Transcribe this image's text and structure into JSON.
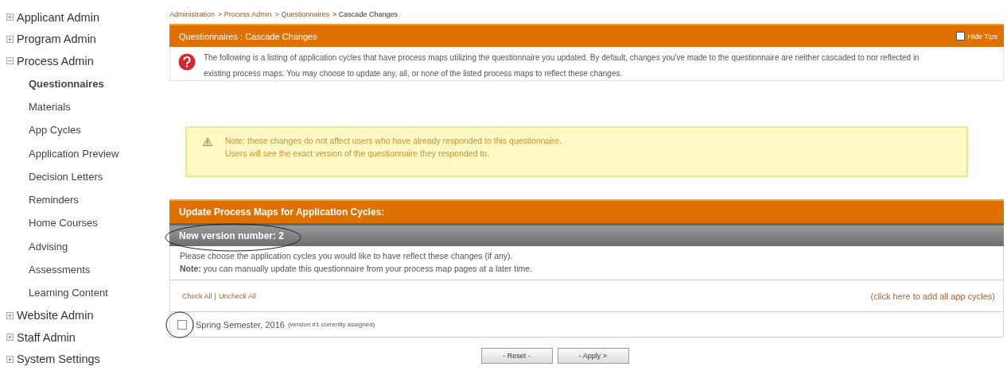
{
  "sidebar": {
    "items": [
      {
        "label": "Applicant Admin",
        "expanded": false
      },
      {
        "label": "Program Admin",
        "expanded": false
      },
      {
        "label": "Process Admin",
        "expanded": true,
        "children": [
          {
            "label": "Questionnaires",
            "selected": true
          },
          {
            "label": "Materials",
            "selected": false
          },
          {
            "label": "App Cycles",
            "selected": false
          },
          {
            "label": "Application Preview",
            "selected": false
          },
          {
            "label": "Decision Letters",
            "selected": false
          },
          {
            "label": "Reminders",
            "selected": false
          },
          {
            "label": "Home Courses",
            "selected": false
          },
          {
            "label": "Advising",
            "selected": false
          },
          {
            "label": "Assessments",
            "selected": false
          },
          {
            "label": "Learning Content",
            "selected": false
          }
        ]
      },
      {
        "label": "Website Admin",
        "expanded": false
      },
      {
        "label": "Staff Admin",
        "expanded": false
      },
      {
        "label": "System Settings",
        "expanded": false
      }
    ]
  },
  "breadcrumb": [
    {
      "label": "Administration",
      "current": false
    },
    {
      "label": "> Process Admin",
      "current": false
    },
    {
      "label": "> Questionnaires",
      "current": false
    },
    {
      "label": "> Cascade Changes",
      "current": true
    }
  ],
  "panel": {
    "title": "Questionnaires : Cascade Changes",
    "hide_tips": {
      "label": "Hide Tips",
      "checked": false
    },
    "tip": "The following is a listing of application cycles that have process maps utilizing the questionnaire you updated. By default, changes you've made to the questionnaire are neither cascaded to nor reflected in existing process maps. You may choose to update any, all, or none of the listed process maps to reflect these changes."
  },
  "note": {
    "lines": [
      "Note: these changes do not affect users who have already responded to this questionnaire.",
      "Users will see the exact version of the questionnaire they responded to."
    ]
  },
  "update": {
    "title": "Update Process Maps for Application Cycles:",
    "version": {
      "text": "New version number: 2",
      "circled": true
    },
    "instructions": [
      "Please choose the application cycles you would like to have reflect these changes (if any).",
      "**Note:** you can manually update this questionnaire from your process map pages at a later time."
    ],
    "check_all": "Check All",
    "separator": "|",
    "uncheck_all": "Uncheck All",
    "add_all": "(click here to add all app cycles)",
    "cycles": [
      {
        "name": "Spring Semester, 2016",
        "detail": "(version #1 currently assigned)",
        "checked": false,
        "circled": true
      }
    ]
  },
  "buttons": [
    "- Reset -",
    "- Apply >"
  ]
}
